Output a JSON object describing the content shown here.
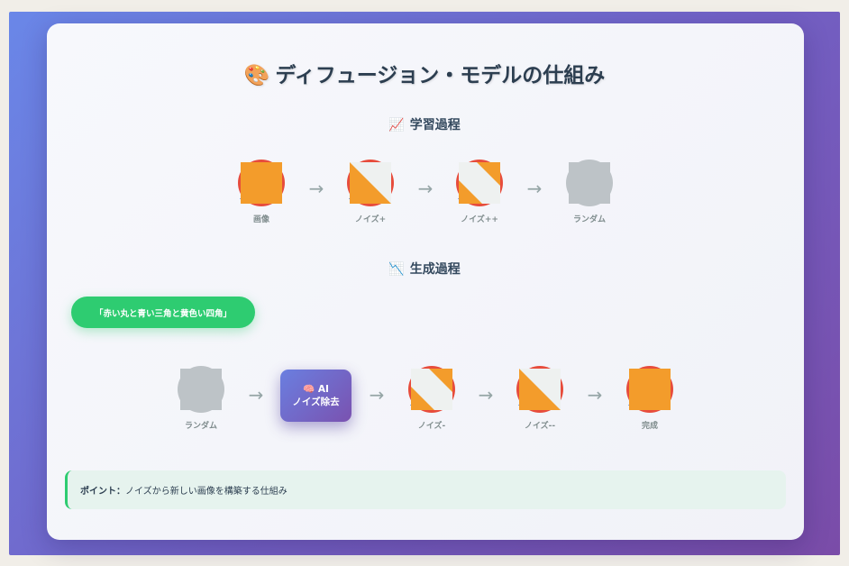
{
  "title": {
    "emoji": "🎨",
    "text": "ディフュージョン・モデルの仕組み"
  },
  "training": {
    "emoji": "📈",
    "title": "学習過程",
    "nodes": [
      {
        "label": "画像",
        "noise": 0
      },
      {
        "label": "ノイズ+",
        "noise": 0.5
      },
      {
        "label": "ノイズ++",
        "noise": 0.75
      },
      {
        "label": "ランダム",
        "noise": 1
      }
    ],
    "arrow": "→"
  },
  "generation": {
    "emoji": "📉",
    "title": "生成過程",
    "prompt": "「赤い丸と青い三角と黄色い四角」",
    "start_label": "ランダム",
    "ai": {
      "emoji": "🧠",
      "line1": "AI",
      "line2": "ノイズ除去"
    },
    "nodes": [
      {
        "label": "ノイズ-",
        "noise": 0.75
      },
      {
        "label": "ノイズ--",
        "noise": 0.5
      },
      {
        "label": "完成",
        "noise": 0
      }
    ],
    "arrow": "→"
  },
  "point": {
    "label": "ポイント：",
    "text": "ノイズから新しい画像を構築する仕組み"
  },
  "colors": {
    "circle": "#e74c3c",
    "triangle": "#3f74c8",
    "square": "#f39c2b",
    "noise": "#eef1f0",
    "random": "#bdc3c7",
    "accent": "#2ecc71"
  }
}
